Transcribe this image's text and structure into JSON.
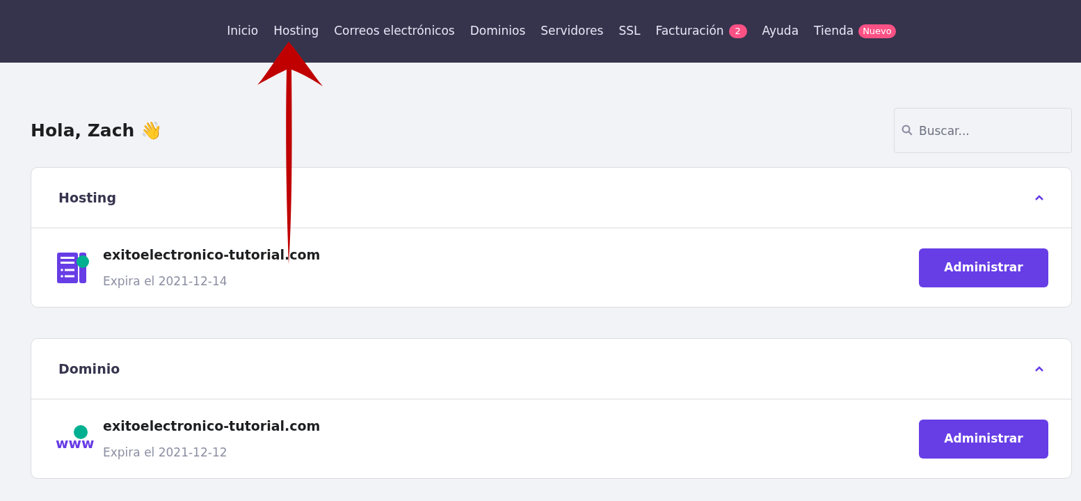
{
  "nav": {
    "items": [
      {
        "label": "Inicio"
      },
      {
        "label": "Hosting"
      },
      {
        "label": "Correos electrónicos"
      },
      {
        "label": "Dominios"
      },
      {
        "label": "Servidores"
      },
      {
        "label": "SSL"
      },
      {
        "label": "Facturación",
        "badge": "2"
      },
      {
        "label": "Ayuda"
      },
      {
        "label": "Tienda",
        "badge": "Nuevo"
      }
    ]
  },
  "greeting": "Hola, Zach 👋",
  "search": {
    "placeholder": "Buscar..."
  },
  "sections": [
    {
      "title": "Hosting",
      "expanded": true,
      "items": [
        {
          "kind": "hosting",
          "name": "exitoelectronico-tutorial.com",
          "expiry": "Expira el 2021-12-14",
          "button": "Administrar"
        }
      ]
    },
    {
      "title": "Dominio",
      "expanded": true,
      "items": [
        {
          "kind": "domain",
          "icon_text": "www",
          "name": "exitoelectronico-tutorial.com",
          "expiry": "Expira el 2021-12-12",
          "button": "Administrar"
        }
      ]
    }
  ]
}
